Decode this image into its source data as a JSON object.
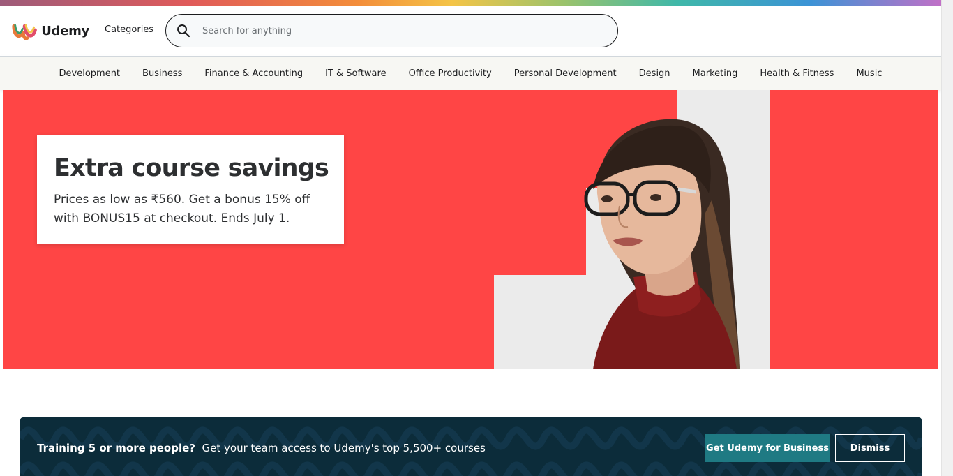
{
  "header": {
    "logo_text": "Udemy",
    "categories_label": "Categories",
    "search_placeholder": "Search for anything"
  },
  "category_nav": [
    "Development",
    "Business",
    "Finance & Accounting",
    "IT & Software",
    "Office Productivity",
    "Personal Development",
    "Design",
    "Marketing",
    "Health & Fitness",
    "Music"
  ],
  "hero": {
    "title": "Extra course savings",
    "text": "Prices as low as ₹560. Get a bonus 15% off with BONUS15 at checkout. Ends July 1.",
    "background_color": "#ff4545"
  },
  "business_banner": {
    "bold_text": "Training 5 or more people?",
    "text": "Get your team access to Udemy's top 5,500+ courses",
    "cta_label": "Get Udemy for Business",
    "dismiss_label": "Dismiss",
    "background_color": "#0c2c3a",
    "cta_color": "#1f7a83"
  },
  "icons": {
    "logo": "udemy-logo-icon",
    "search": "search-icon"
  }
}
